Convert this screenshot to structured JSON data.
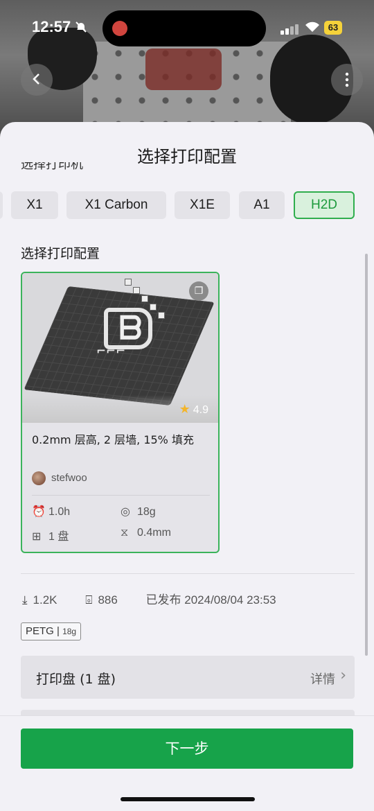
{
  "status_bar": {
    "time": "12:57",
    "battery": "63"
  },
  "nav": {
    "back_icon": "chevron-left-icon",
    "more_icon": "more-vertical-icon"
  },
  "sheet": {
    "title": "选择打印配置",
    "cut_label": "选择打印机",
    "printer_chips": [
      "X1",
      "X1 Carbon",
      "X1E",
      "A1",
      "H2D"
    ],
    "active_printer": "H2D",
    "section_title": "选择打印配置"
  },
  "profile_card": {
    "description": "0.2mm 层高, 2 层墙, 15% 填充",
    "author": "stefwoo",
    "rating": "4.9",
    "print_time": "1.0h",
    "filament_weight": "18g",
    "plates": "1 盘",
    "nozzle": "0.4mm"
  },
  "stats": {
    "downloads": "1.2K",
    "prints": "886",
    "published": "已发布 2024/08/04 23:53"
  },
  "material_tag": {
    "material": "PETG",
    "weight": "18g"
  },
  "plate_row": {
    "label": "打印盘",
    "count": "(1 盘)",
    "detail": "详情"
  },
  "footer": {
    "next_label": "下一步"
  },
  "colors": {
    "accent": "#17a34a",
    "chip_active_bg": "#d9f1dd",
    "sheet_bg": "#f2f1f6"
  }
}
